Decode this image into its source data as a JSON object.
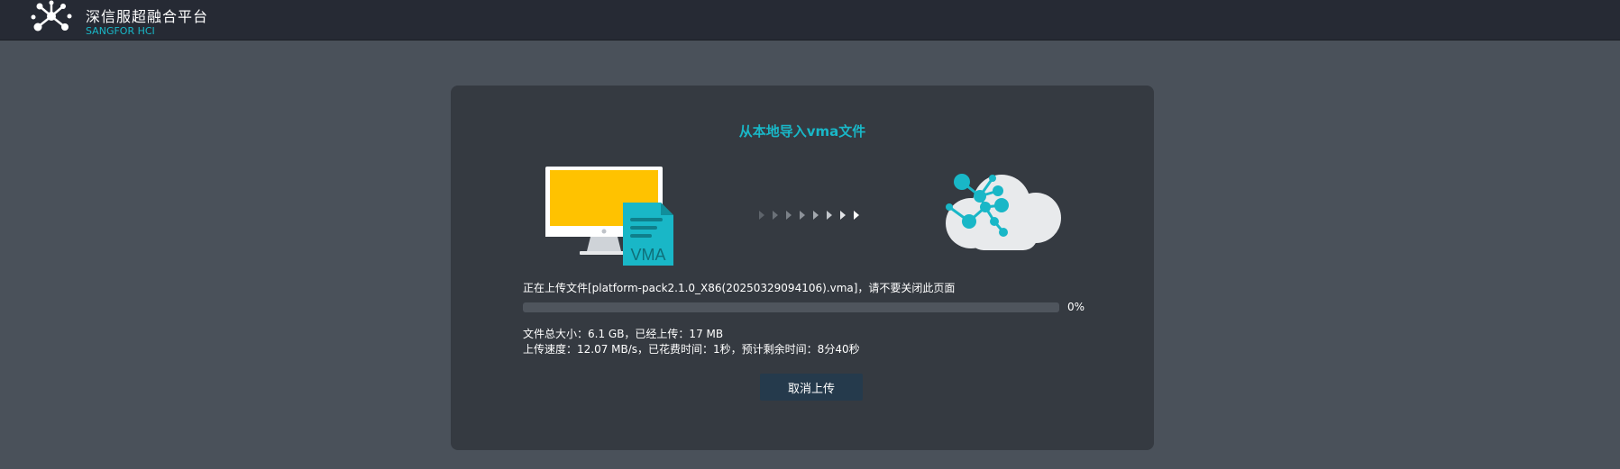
{
  "header": {
    "title": "深信服超融合平台",
    "subtitle": "SANGFOR HCI",
    "logo_icon": "molecule-logo-icon"
  },
  "dialog": {
    "title": "从本地导入vma文件",
    "source_icon": "monitor-with-vma-file-icon",
    "file_badge": "VMA",
    "transfer_icon": "arrows-right-icon",
    "target_icon": "cloud-network-icon",
    "status_text": "正在上传文件[platform-pack2.1.0_X86(20250329094106).vma]，请不要关闭此页面",
    "progress_fraction": 0,
    "progress_label": "0%",
    "size_info": "文件总大小：6.1 GB，已经上传：17 MB",
    "speed_info": "上传速度：12.07 MB/s，已花费时间：1秒，预计剩余时间：8分40秒",
    "cancel_label": "取消上传"
  },
  "colors": {
    "accent": "#19b7c7",
    "topbar": "#262a34",
    "background": "#4a515a",
    "dialog": "#353a41",
    "monitor_screen": "#ffc200",
    "button": "#253a4c"
  }
}
